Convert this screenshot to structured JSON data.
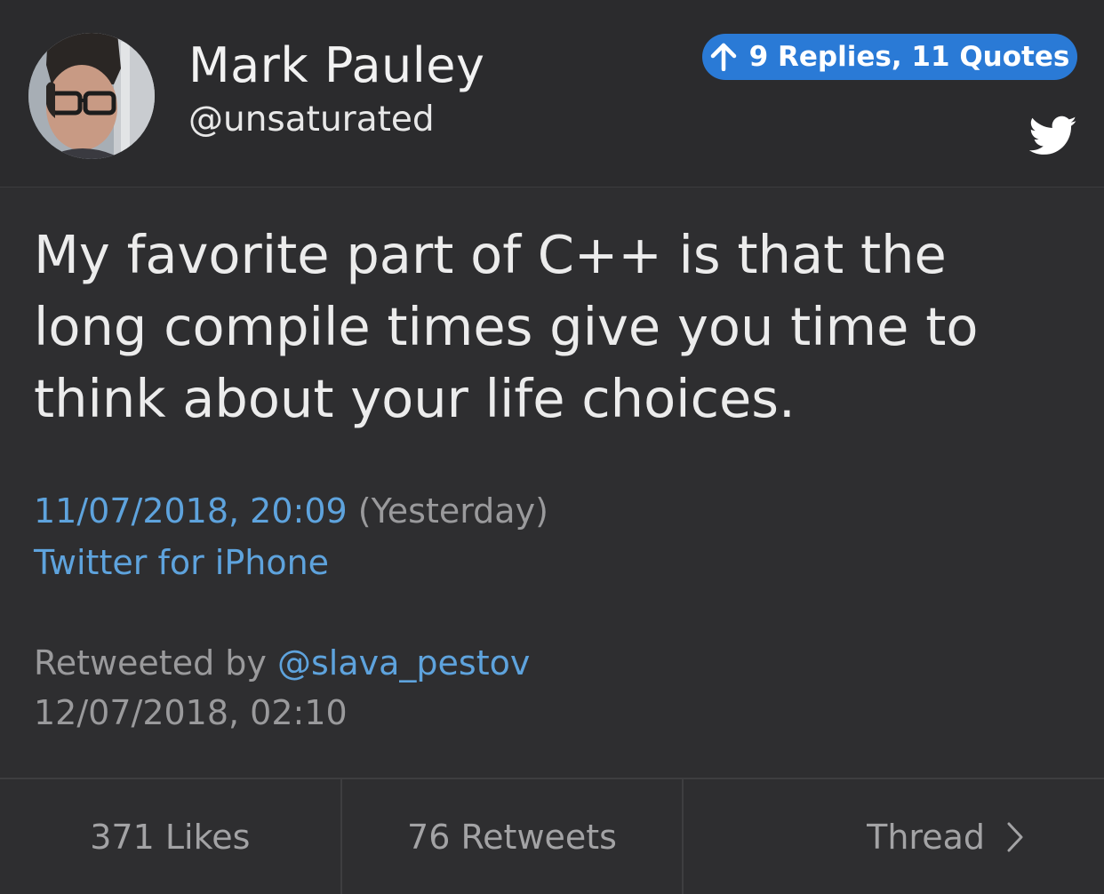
{
  "author": {
    "display_name": "Mark Pauley",
    "handle": "@unsaturated"
  },
  "replies_badge": {
    "label": "9 Replies, 11 Quotes",
    "icon": "arrow-up-icon"
  },
  "brand_icon": "twitter-bird-icon",
  "tweet": {
    "text": "My favorite part of C++ is that the long compile times give you time to think about your life choices.",
    "date": "11/07/2018, 20:09",
    "relative": "(Yesterday)",
    "client": "Twitter for iPhone"
  },
  "retweet": {
    "prefix": "Retweeted by",
    "user": "@slava_pestov",
    "date": "12/07/2018, 02:10"
  },
  "footer": {
    "likes": "371 Likes",
    "retweets": "76 Retweets",
    "thread": "Thread"
  },
  "colors": {
    "background": "#2e2e30",
    "accent_blue": "#2a7ad6",
    "link_blue": "#5ea3dd",
    "muted_grey": "#9a9a9c"
  }
}
